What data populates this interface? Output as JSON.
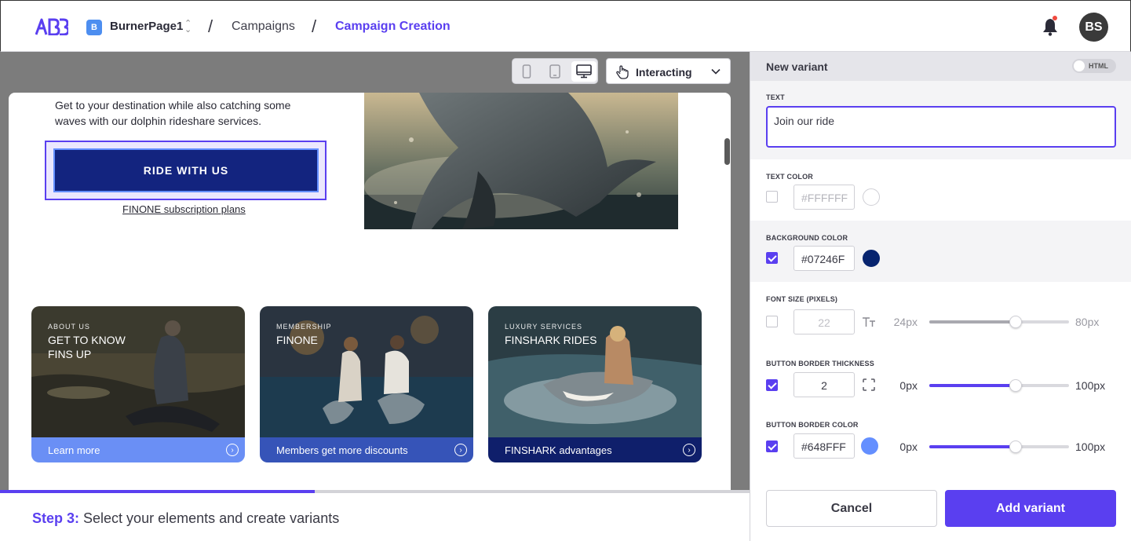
{
  "header": {
    "logo_text": "ABB",
    "workspace_badge": "B",
    "workspace_name": "BurnerPage1",
    "breadcrumbs": [
      "Campaigns",
      "Campaign Creation"
    ],
    "avatar_initials": "BS"
  },
  "toolbar": {
    "devices": [
      "mobile-icon",
      "tablet-icon",
      "desktop-icon"
    ],
    "selected_device": "desktop",
    "mode_label": "Interacting"
  },
  "preview": {
    "hero_text": "Get to your destination while also catching some waves with our dolphin rideshare services.",
    "cta_label": "RIDE WITH US",
    "sub_link": "FINONE subscription plans",
    "cards": [
      {
        "kicker": "ABOUT US",
        "title": "GET TO KNOW FINS UP",
        "footer": "Learn more",
        "footer_color": "#6a8ff5"
      },
      {
        "kicker": "MEMBERSHIP",
        "title": "FINONE",
        "footer": "Members get more discounts",
        "footer_color": "#3654b8"
      },
      {
        "kicker": "LUXURY SERVICES",
        "title": "FINSHARK RIDES",
        "footer": "FINSHARK advantages",
        "footer_color": "#0f1f6b"
      }
    ]
  },
  "progress": {
    "fraction": 0.42
  },
  "footer": {
    "step_label": "Step 3:",
    "step_text": "Select your elements and create variants"
  },
  "panel": {
    "title": "New variant",
    "html_toggle_label": "HTML",
    "text": {
      "label": "TEXT",
      "value": "Join our ride"
    },
    "text_color": {
      "label": "TEXT COLOR",
      "checked": false,
      "value": "#FFFFFF"
    },
    "background_color": {
      "label": "BACKGROUND COLOR",
      "checked": true,
      "value": "#07246F"
    },
    "font_size": {
      "label": "FONT SIZE (PIXELS)",
      "checked": false,
      "value": "22",
      "min": "24px",
      "max": "80px",
      "level": 0.62
    },
    "border_thickness": {
      "label": "BUTTON BORDER THICKNESS",
      "checked": true,
      "value": "2",
      "min": "0px",
      "max": "100px",
      "level": 0.62
    },
    "border_color": {
      "label": "BUTTON BORDER COLOR",
      "checked": true,
      "value": "#648FFF",
      "min": "0px",
      "max": "100px",
      "level": 0.62
    },
    "cancel_label": "Cancel",
    "add_label": "Add variant"
  }
}
